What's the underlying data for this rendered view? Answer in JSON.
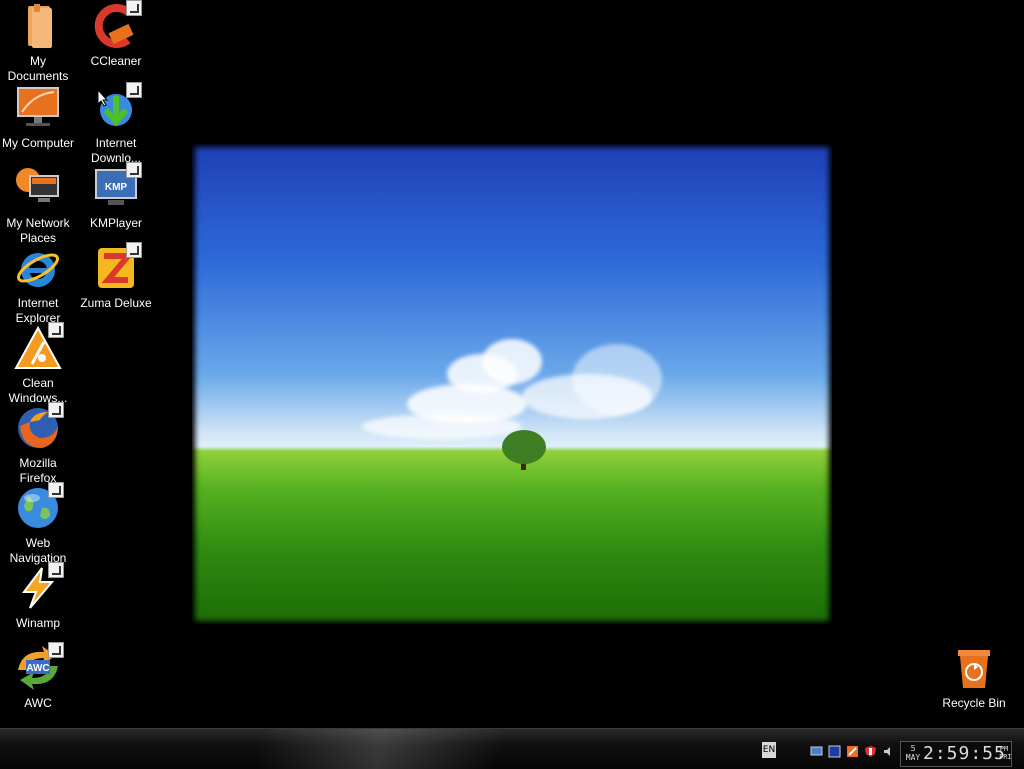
{
  "desktop": {
    "icons": [
      {
        "label": "My\nDocuments",
        "icon": "folder-icon"
      },
      {
        "label": "CCleaner",
        "icon": "ccleaner-icon"
      },
      {
        "label": "My Computer",
        "icon": "computer-icon"
      },
      {
        "label": "Internet\nDownlo...",
        "icon": "download-manager-icon"
      },
      {
        "label": "My Network\nPlaces",
        "icon": "network-icon"
      },
      {
        "label": "KMPlayer",
        "icon": "media-player-icon"
      },
      {
        "label": "Internet\nExplorer",
        "icon": "internet-explorer-icon"
      },
      {
        "label": "Zuma Deluxe",
        "icon": "zuma-icon"
      },
      {
        "label": "Clean\nWindows...",
        "icon": "warning-cleaner-icon"
      },
      {
        "label": "Mozilla\nFirefox",
        "icon": "firefox-icon"
      },
      {
        "label": "Web\nNavigation",
        "icon": "globe-icon"
      },
      {
        "label": "Winamp",
        "icon": "winamp-icon"
      },
      {
        "label": "AWC",
        "icon": "awc-icon"
      },
      {
        "label": "Recycle Bin",
        "icon": "recycle-bin-icon"
      }
    ]
  },
  "taskbar": {
    "language": "EN",
    "clock": {
      "day_num": "5",
      "month": "MAY",
      "time": "2:59:55",
      "ampm": "PM",
      "weekday": "FRI"
    }
  },
  "colors": {
    "accent_orange": "#e8711d",
    "sky_blue": "#2e6bd8",
    "grass_green": "#55b020"
  }
}
